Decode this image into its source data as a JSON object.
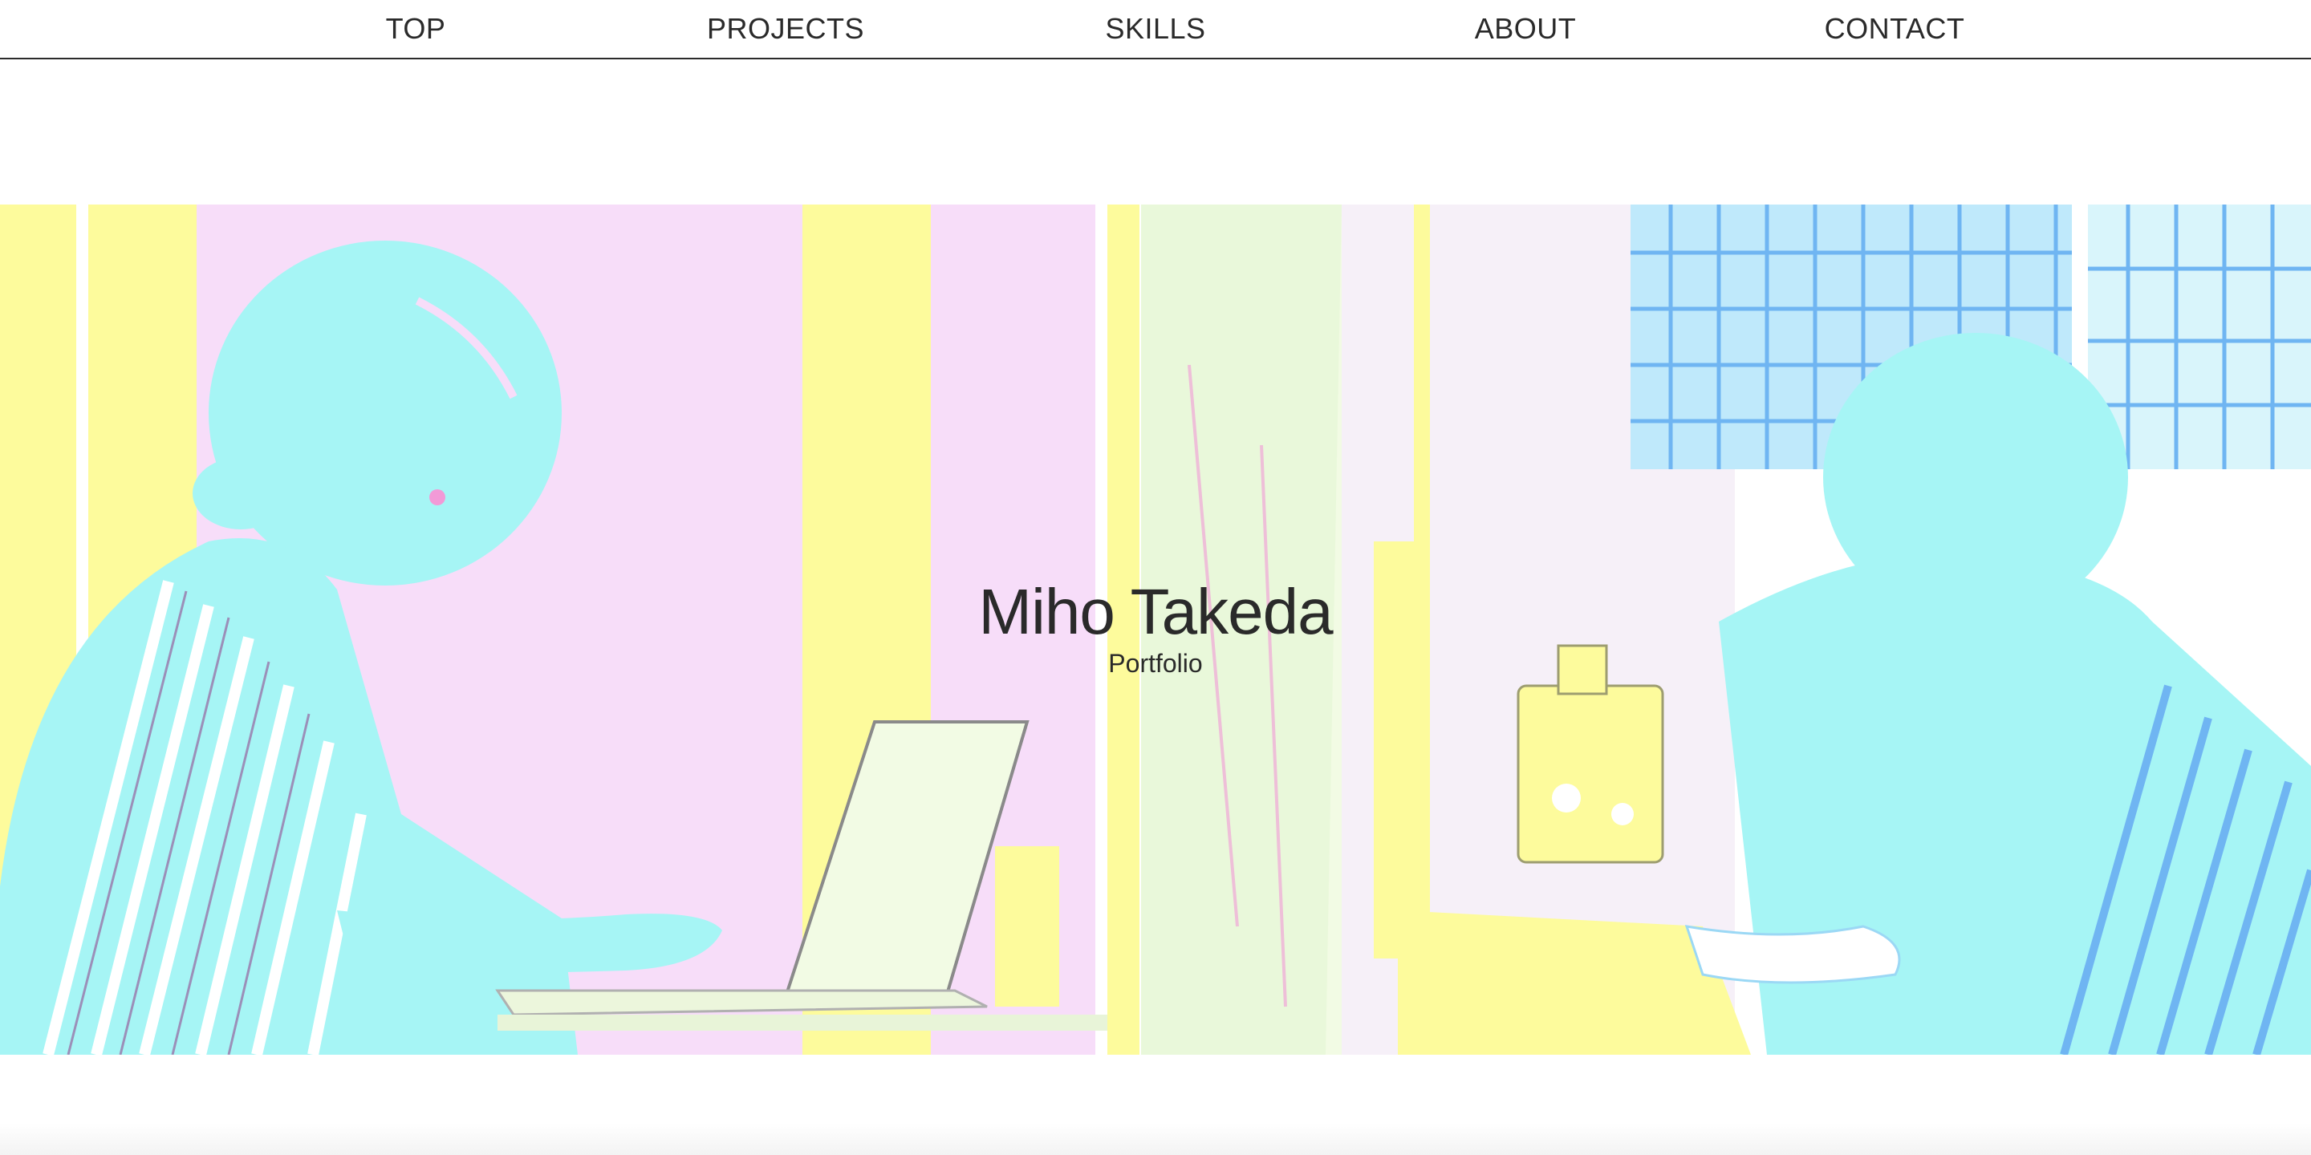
{
  "nav": {
    "items": [
      {
        "label": "TOP"
      },
      {
        "label": "PROJECTS"
      },
      {
        "label": "SKILLS"
      },
      {
        "label": "ABOUT"
      },
      {
        "label": "CONTACT"
      }
    ]
  },
  "hero": {
    "name": "Miho Takeda",
    "subtitle": "Portfolio"
  },
  "colors": {
    "text": "#2a2a2a",
    "cyan": "#a6f5f5",
    "pink": "#f7ddf9",
    "yellow": "#fdfb9c",
    "pale_green": "#f2fbe4",
    "blue_stripe": "#6fb5f2"
  }
}
